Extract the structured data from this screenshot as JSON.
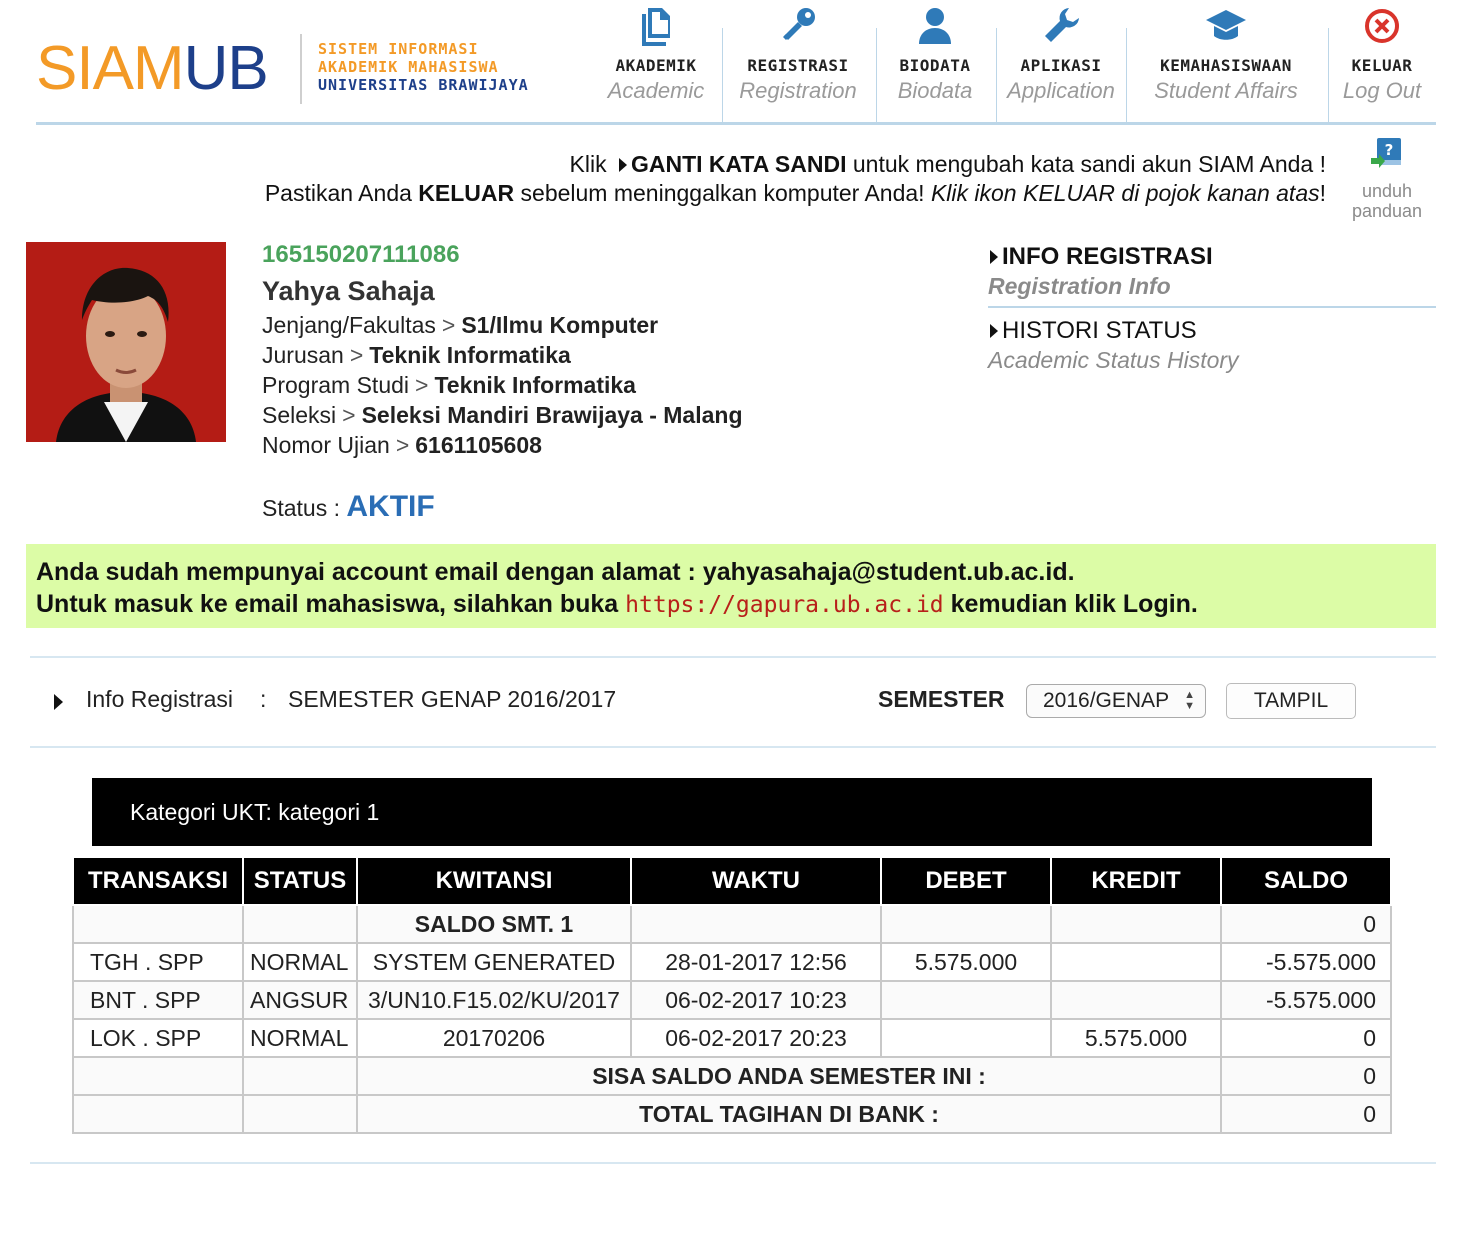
{
  "logo": {
    "siam": "SIAM",
    "ub": "UB",
    "line1": "SISTEM INFORMASI",
    "line2": "AKADEMIK MAHASISWA",
    "line3": "UNIVERSITAS BRAWIJAYA"
  },
  "nav": [
    {
      "label": "AKADEMIK",
      "sub": "Academic",
      "icon": "document-copy-icon"
    },
    {
      "label": "REGISTRASI",
      "sub": "Registration",
      "icon": "key-icon"
    },
    {
      "label": "BIODATA",
      "sub": "Biodata",
      "icon": "user-icon"
    },
    {
      "label": "APLIKASI",
      "sub": "Application",
      "icon": "wrench-icon"
    },
    {
      "label": "KEMAHASISWAAN",
      "sub": "Student Affairs",
      "icon": "graduation-cap-icon"
    },
    {
      "label": "KELUAR",
      "sub": "Log Out",
      "icon": "close-circle-icon"
    }
  ],
  "notice": {
    "l1a": "Klik",
    "l1b": "GANTI KATA SANDI",
    "l1c": "untuk mengubah kata sandi akun SIAM Anda !",
    "l2a": "Pastikan Anda",
    "l2b": "KELUAR",
    "l2c": "sebelum meninggalkan komputer Anda!",
    "l2d": "Klik ikon KELUAR di pojok kanan atas",
    "l2e": "!"
  },
  "help": {
    "l1": "unduh",
    "l2": "panduan"
  },
  "profile": {
    "nim": "165150207111086",
    "name": "Yahya Sahaja",
    "rows": [
      {
        "k": "Jenjang/Fakultas",
        "v": "S1/Ilmu Komputer"
      },
      {
        "k": "Jurusan",
        "v": "Teknik Informatika"
      },
      {
        "k": "Program Studi",
        "v": "Teknik Informatika"
      },
      {
        "k": "Seleksi",
        "v": "Seleksi Mandiri Brawijaya - Malang"
      },
      {
        "k": "Nomor Ujian",
        "v": "6161105608"
      }
    ],
    "status_label": "Status :",
    "status_value": "AKTIF"
  },
  "side": {
    "i1_title": "INFO REGISTRASI",
    "i1_sub": "Registration Info",
    "i2_title": "HISTORI STATUS",
    "i2_sub": "Academic Status History"
  },
  "email": {
    "l1": "Anda sudah mempunyai account email dengan alamat : yahyasahaja@student.ub.ac.id.",
    "l2a": "Untuk masuk ke email mahasiswa, silahkan buka",
    "l2link": "https://gapura.ub.ac.id",
    "l2b": "kemudian klik Login."
  },
  "sembar": {
    "label": "Info Registrasi",
    "colon": ":",
    "value": "SEMESTER GENAP 2016/2017",
    "sem_label": "SEMESTER",
    "select_value": "2016/GENAP",
    "button": "TAMPIL"
  },
  "ukt": "Kategori UKT: kategori 1",
  "table": {
    "headers": [
      "TRANSAKSI",
      "STATUS",
      "KWITANSI",
      "WAKTU",
      "DEBET",
      "KREDIT",
      "SALDO"
    ],
    "saldo_awal_label": "SALDO SMT. 1",
    "saldo_awal": "0",
    "rows": [
      [
        "TGH . SPP",
        "NORMAL",
        "SYSTEM GENERATED",
        "28-01-2017 12:56",
        "5.575.000",
        "",
        "-5.575.000"
      ],
      [
        "BNT . SPP",
        "ANGSUR",
        "3/UN10.F15.02/KU/2017",
        "06-02-2017 10:23",
        "",
        "",
        "-5.575.000"
      ],
      [
        "LOK . SPP",
        "NORMAL",
        "20170206",
        "06-02-2017 20:23",
        "",
        "5.575.000",
        "0"
      ]
    ],
    "sisa_label": "SISA SALDO ANDA SEMESTER INI :",
    "sisa": "0",
    "total_label": "TOTAL TAGIHAN DI BANK :",
    "total": "0"
  }
}
